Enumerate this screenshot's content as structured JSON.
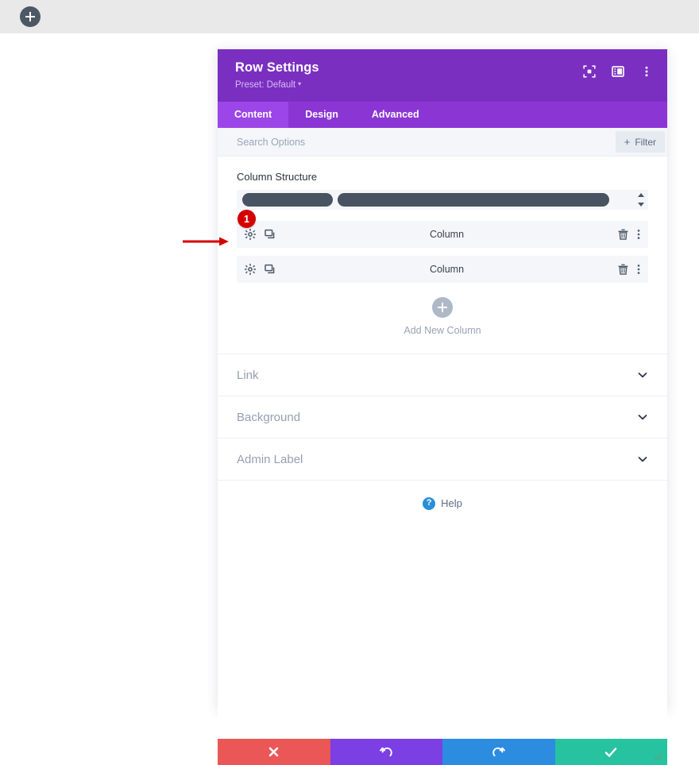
{
  "top_bar": {
    "add_section_icon": "plus-icon",
    "background": "#e9e9ea"
  },
  "modal": {
    "title": "Row Settings",
    "preset_label": "Preset: Default",
    "preset_caret": "▾",
    "header_color": "#7b2fc1",
    "header_actions": [
      {
        "name": "focus-target-icon",
        "tooltip": ""
      },
      {
        "name": "layout-panel-icon",
        "tooltip": ""
      },
      {
        "name": "more-vertical-icon",
        "tooltip": ""
      }
    ],
    "tabs": [
      {
        "label": "Content",
        "active": true
      },
      {
        "label": "Design",
        "active": false
      },
      {
        "label": "Advanced",
        "active": false
      }
    ],
    "tab_bar_color": "#8b36d4",
    "tab_active_color": "#9c45e8",
    "search": {
      "placeholder": "Search Options",
      "value": ""
    },
    "filter_button": {
      "label": "Filter",
      "plus": "+"
    },
    "column_structure": {
      "label": "Column Structure",
      "segments": [
        {
          "width_percent": 33
        },
        {
          "width_percent": 67
        }
      ],
      "stepper_icon": "updown-arrows-icon"
    },
    "columns": [
      {
        "label": "Column",
        "badge": "1",
        "left_icons": [
          "gear-icon",
          "duplicate-icon"
        ],
        "right_icons": [
          "trash-icon",
          "more-vertical-icon"
        ]
      },
      {
        "label": "Column",
        "badge": "",
        "left_icons": [
          "gear-icon",
          "duplicate-icon"
        ],
        "right_icons": [
          "trash-icon",
          "more-vertical-icon"
        ]
      }
    ],
    "add_new_column": {
      "label": "Add New Column",
      "icon": "plus-circle-icon"
    },
    "accordions": [
      {
        "label": "Link",
        "expanded": false,
        "chevron": "chevron-down-icon"
      },
      {
        "label": "Background",
        "expanded": false,
        "chevron": "chevron-down-icon"
      },
      {
        "label": "Admin Label",
        "expanded": false,
        "chevron": "chevron-down-icon"
      }
    ],
    "help": {
      "label": "Help",
      "icon": "question-circle-icon",
      "icon_color": "#2a8fd8"
    },
    "footer_buttons": [
      {
        "name": "discard-button",
        "icon": "close-x-icon",
        "color": "#eb5757"
      },
      {
        "name": "undo-button",
        "icon": "undo-arrow-icon",
        "color": "#7b3fe4"
      },
      {
        "name": "redo-button",
        "icon": "redo-arrow-icon",
        "color": "#2b8ce0"
      },
      {
        "name": "save-button",
        "icon": "checkmark-icon",
        "color": "#27c2a0"
      }
    ]
  },
  "annotation": {
    "arrow_color": "#d40000",
    "badge_color": "#d40000",
    "badge_text": "1"
  }
}
